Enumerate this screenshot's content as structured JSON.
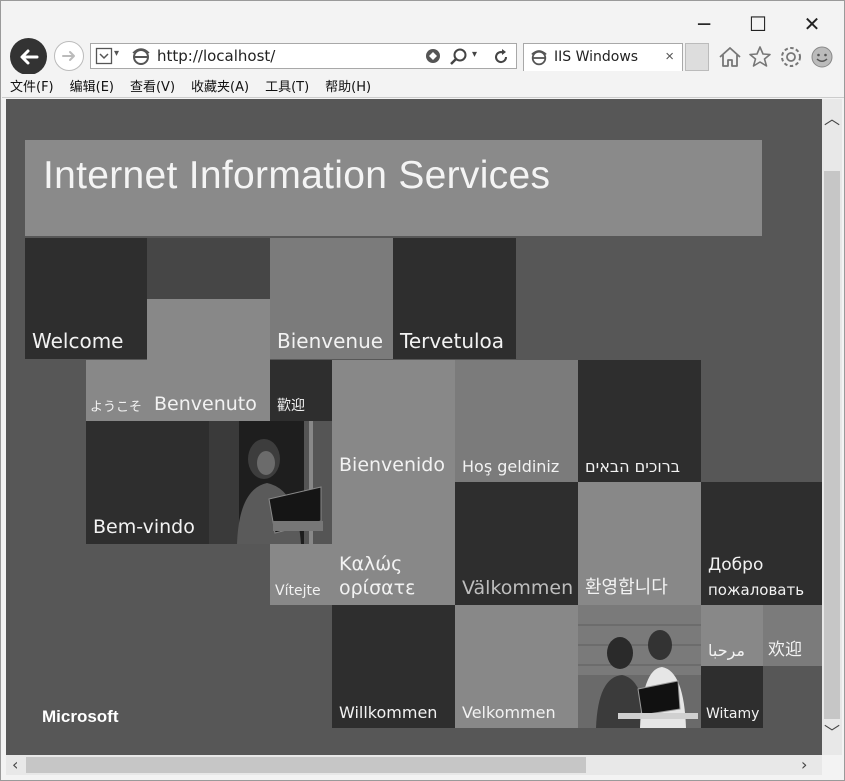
{
  "window": {
    "caption": {
      "minimize": "─",
      "maximize": "☐",
      "close": "✕"
    }
  },
  "address": {
    "url": "http://localhost/"
  },
  "tab": {
    "title": "IIS Windows",
    "close": "×"
  },
  "menu": [
    "文件(F)",
    "编辑(E)",
    "查看(V)",
    "收藏夹(A)",
    "工具(T)",
    "帮助(H)"
  ],
  "page": {
    "title": "Internet Information Services",
    "brand": "Microsoft",
    "tiles": {
      "welcome": "Welcome",
      "bienvenue": "Bienvenue",
      "tervetuloa": "Tervetuloa",
      "youkoso": "ようこそ",
      "benvenuto": "Benvenuto",
      "huanying_tw": "歡迎",
      "bienvenido": "Bienvenido",
      "hosgeldiniz": "Hoş geldiniz",
      "hebrew": "ברוכים הבאים",
      "bemvindo": "Bem-vindo",
      "vitejte": "Vítejte",
      "kalos_1": "Καλώς",
      "kalos_2": "ορίσατε",
      "valkommen": "Välkommen",
      "korean": "환영합니다",
      "dobro_1": "Добро",
      "dobro_2": "пожаловать",
      "arabic": "مرحبا",
      "huanying_cn": "欢迎",
      "willkommen": "Willkommen",
      "velkommen": "Velkommen",
      "witamy": "Witamy"
    }
  }
}
